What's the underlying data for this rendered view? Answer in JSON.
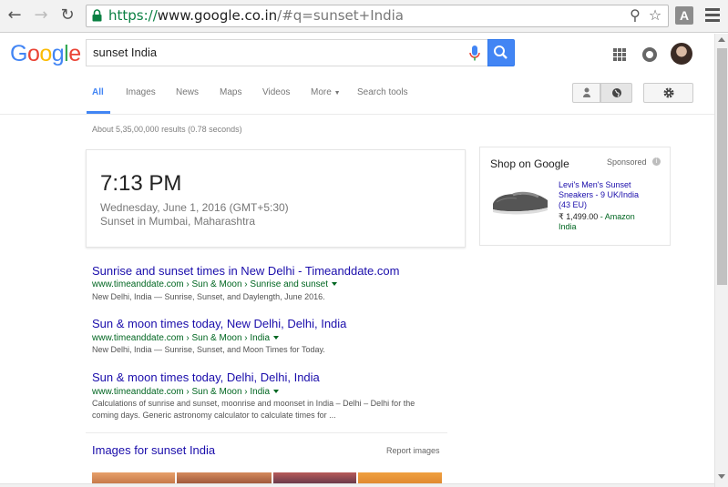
{
  "browser": {
    "url_scheme": "https://",
    "url_host": "www.google.co.in",
    "url_path": "/#q=sunset+India",
    "extension_label": "A",
    "icons": [
      "back-icon",
      "forward-icon",
      "reload-icon",
      "lock-icon",
      "zoom-icon",
      "star-icon",
      "menu-icon"
    ]
  },
  "header": {
    "logo_letters": [
      {
        "ch": "G",
        "color": "#4285F4"
      },
      {
        "ch": "o",
        "color": "#EA4335"
      },
      {
        "ch": "o",
        "color": "#FBBC05"
      },
      {
        "ch": "g",
        "color": "#4285F4"
      },
      {
        "ch": "l",
        "color": "#34A853"
      },
      {
        "ch": "e",
        "color": "#EA4335"
      }
    ],
    "search_query": "sunset India"
  },
  "tabs": {
    "all": "All",
    "images": "Images",
    "news": "News",
    "maps": "Maps",
    "videos": "Videos",
    "more": "More",
    "search_tools": "Search tools"
  },
  "results_stats": "About 5,35,00,000 results (0.78 seconds)",
  "time_card": {
    "time": "7:13 PM",
    "date": "Wednesday, June 1, 2016 (GMT+5:30)",
    "place": "Sunset in Mumbai, Maharashtra"
  },
  "shop": {
    "title": "Shop on Google",
    "sponsored": "Sponsored",
    "product_line1": "Levi's Men's Sunset",
    "product_line2": "Sneakers - 9 UK/India",
    "product_line3": "(43 EU)",
    "price": "₹ 1,499.00",
    "store_sep": " - Amazon",
    "store_line2": "India"
  },
  "results": [
    {
      "title": "Sunrise and sunset times in New Delhi - Timeanddate.com",
      "url": "www.timeanddate.com › Sun & Moon › Sunrise and sunset",
      "snippet": "New Delhi, India — Sunrise, Sunset, and Daylength, June 2016."
    },
    {
      "title": "Sun & moon times today, New Delhi, Delhi, India",
      "url": "www.timeanddate.com › Sun & Moon › India",
      "snippet": "New Delhi, India — Sunrise, Sunset, and Moon Times for Today."
    },
    {
      "title": "Sun & moon times today, Delhi, Delhi, India",
      "url": "www.timeanddate.com › Sun & Moon › India",
      "snippet_line1": "Calculations of sunrise and sunset, moonrise and moonset in India – Delhi – Delhi for the",
      "snippet_line2": "coming days. Generic astronomy calculator to calculate times for ..."
    }
  ],
  "images_section": {
    "title": "Images for sunset India",
    "report": "Report images"
  }
}
